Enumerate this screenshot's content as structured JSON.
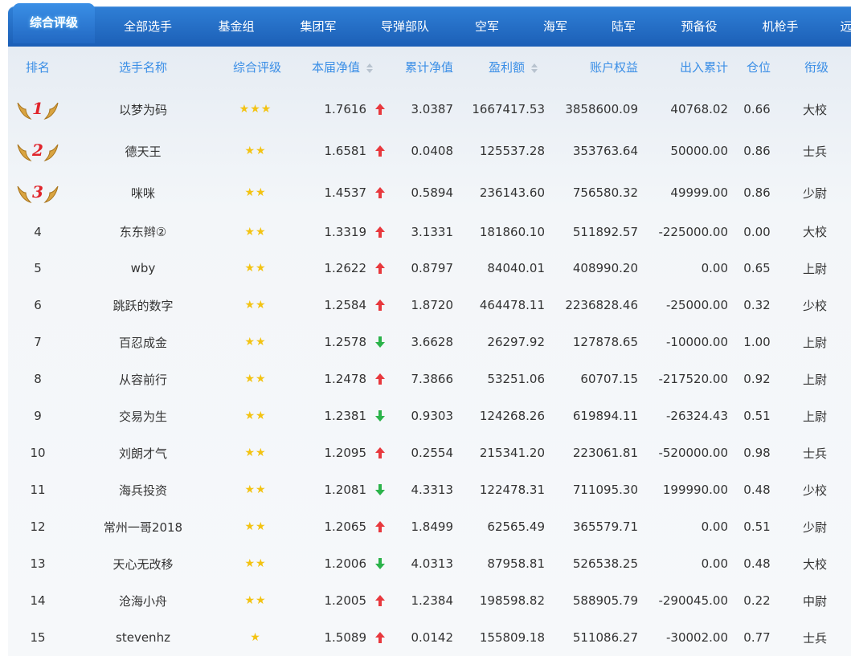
{
  "tabs": [
    "综合评级",
    "全部选手",
    "基金组",
    "集团军",
    "导弹部队",
    "空军",
    "海军",
    "陆军",
    "预备役",
    "机枪手",
    "远"
  ],
  "headers": {
    "rank": "排名",
    "name": "选手名称",
    "rating": "综合评级",
    "nav": "本届净值",
    "cum_nav": "累计净值",
    "profit": "盈利额",
    "equity": "账户权益",
    "flow": "出入累计",
    "position": "仓位",
    "grade": "衔级"
  },
  "colors": {
    "header_text": "#3a8ee6",
    "tab_bg": "#1c5fb6",
    "up_arrow": "#e8383d",
    "down_arrow": "#2bb34a",
    "star": "#f3c312"
  },
  "rows": [
    {
      "rank": "1",
      "name": "以梦为码",
      "stars": "★★★",
      "nav": "1.7616",
      "trend": "up",
      "cum": "3.0387",
      "profit": "1667417.53",
      "equity": "3858600.09",
      "flow": "40768.02",
      "pos": "0.66",
      "grade": "大校"
    },
    {
      "rank": "2",
      "name": "德天王",
      "stars": "★★",
      "nav": "1.6581",
      "trend": "up",
      "cum": "0.0408",
      "profit": "125537.28",
      "equity": "353763.64",
      "flow": "50000.00",
      "pos": "0.86",
      "grade": "士兵"
    },
    {
      "rank": "3",
      "name": "咪咪",
      "stars": "★★",
      "nav": "1.4537",
      "trend": "up",
      "cum": "0.5894",
      "profit": "236143.60",
      "equity": "756580.32",
      "flow": "49999.00",
      "pos": "0.86",
      "grade": "少尉"
    },
    {
      "rank": "4",
      "name": "东东辫②",
      "stars": "★★",
      "nav": "1.3319",
      "trend": "up",
      "cum": "3.1331",
      "profit": "181860.10",
      "equity": "511892.57",
      "flow": "-225000.00",
      "pos": "0.00",
      "grade": "大校"
    },
    {
      "rank": "5",
      "name": "wby",
      "stars": "★★",
      "nav": "1.2622",
      "trend": "up",
      "cum": "0.8797",
      "profit": "84040.01",
      "equity": "408990.20",
      "flow": "0.00",
      "pos": "0.65",
      "grade": "上尉"
    },
    {
      "rank": "6",
      "name": "跳跃的数字",
      "stars": "★★",
      "nav": "1.2584",
      "trend": "up",
      "cum": "1.8720",
      "profit": "464478.11",
      "equity": "2236828.46",
      "flow": "-25000.00",
      "pos": "0.32",
      "grade": "少校"
    },
    {
      "rank": "7",
      "name": "百忍成金",
      "stars": "★★",
      "nav": "1.2578",
      "trend": "down",
      "cum": "3.6628",
      "profit": "26297.92",
      "equity": "127878.65",
      "flow": "-10000.00",
      "pos": "1.00",
      "grade": "上尉"
    },
    {
      "rank": "8",
      "name": "从容前行",
      "stars": "★★",
      "nav": "1.2478",
      "trend": "up",
      "cum": "7.3866",
      "profit": "53251.06",
      "equity": "60707.15",
      "flow": "-217520.00",
      "pos": "0.92",
      "grade": "上尉"
    },
    {
      "rank": "9",
      "name": "交易为生",
      "stars": "★★",
      "nav": "1.2381",
      "trend": "down",
      "cum": "0.9303",
      "profit": "124268.26",
      "equity": "619894.11",
      "flow": "-26324.43",
      "pos": "0.51",
      "grade": "上尉"
    },
    {
      "rank": "10",
      "name": "刘朗才气",
      "stars": "★★",
      "nav": "1.2095",
      "trend": "up",
      "cum": "0.2554",
      "profit": "215341.20",
      "equity": "223061.81",
      "flow": "-520000.00",
      "pos": "0.98",
      "grade": "士兵"
    },
    {
      "rank": "11",
      "name": "海兵投资",
      "stars": "★★",
      "nav": "1.2081",
      "trend": "down",
      "cum": "4.3313",
      "profit": "122478.31",
      "equity": "711095.30",
      "flow": "199990.00",
      "pos": "0.48",
      "grade": "少校"
    },
    {
      "rank": "12",
      "name": "常州一哥2018",
      "stars": "★★",
      "nav": "1.2065",
      "trend": "up",
      "cum": "1.8499",
      "profit": "62565.49",
      "equity": "365579.71",
      "flow": "0.00",
      "pos": "0.51",
      "grade": "少尉"
    },
    {
      "rank": "13",
      "name": "天心无改移",
      "stars": "★★",
      "nav": "1.2006",
      "trend": "down",
      "cum": "4.0313",
      "profit": "87958.81",
      "equity": "526538.25",
      "flow": "0.00",
      "pos": "0.48",
      "grade": "大校"
    },
    {
      "rank": "14",
      "name": "沧海小舟",
      "stars": "★★",
      "nav": "1.2005",
      "trend": "up",
      "cum": "1.2384",
      "profit": "198598.82",
      "equity": "588905.79",
      "flow": "-290045.00",
      "pos": "0.22",
      "grade": "中尉"
    },
    {
      "rank": "15",
      "name": "stevenhz",
      "stars": "★",
      "nav": "1.5089",
      "trend": "up",
      "cum": "0.0142",
      "profit": "155809.18",
      "equity": "511086.27",
      "flow": "-30002.00",
      "pos": "0.77",
      "grade": "士兵"
    }
  ]
}
